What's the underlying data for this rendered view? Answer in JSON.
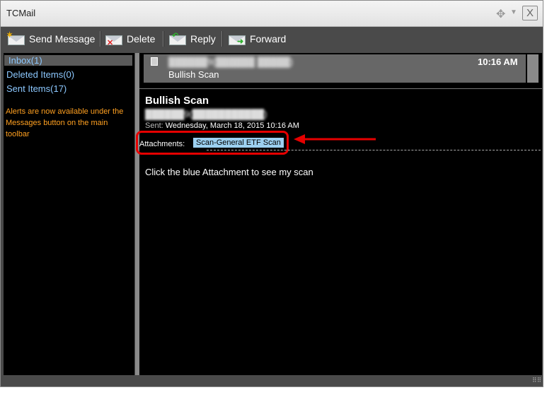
{
  "window": {
    "title": "TCMail"
  },
  "toolbar": {
    "send_label": "Send Message",
    "delete_label": "Delete",
    "reply_label": "Reply",
    "forward_label": "Forward"
  },
  "sidebar": {
    "items": [
      {
        "label": "Inbox(1)"
      },
      {
        "label": "Deleted Items(0)"
      },
      {
        "label": "Sent Items(17)"
      }
    ],
    "notice": "Alerts are now available under the Messages button on the main toolbar"
  },
  "message_list": {
    "rows": [
      {
        "time": "10:16 AM",
        "subject": "Bullish Scan"
      }
    ]
  },
  "message": {
    "subject": "Bullish Scan",
    "sent_label": "Sent:",
    "sent_value": "Wednesday, March 18, 2015 10:16 AM",
    "attachments_label": "Attachments:",
    "attachment_name": "Scan-General ETF Scan",
    "body": "Click the blue Attachment to see my scan"
  },
  "colors": {
    "sidebar_link": "#8cc8ff",
    "notice": "#ffa020",
    "highlight_box": "#e60000",
    "attachment_bg": "#9cd0f0"
  }
}
